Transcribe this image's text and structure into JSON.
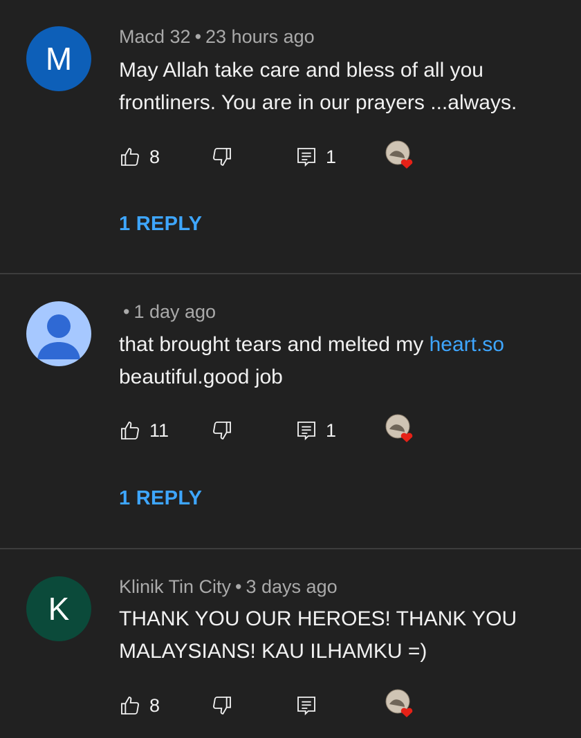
{
  "comments": [
    {
      "avatar_letter": "M",
      "avatar_color": "#0d5fb8",
      "author": "Macd 32",
      "separator": "•",
      "time": "23 hours ago",
      "text": "May Allah take care and bless of all you frontliners. You are in our prayers ...always.",
      "likes": "8",
      "reply_count": "1",
      "replies_label": "1 REPLY"
    },
    {
      "avatar_icon": "default-user-icon",
      "avatar_color": "#a6c8ff",
      "author": "",
      "separator": "•",
      "time": "1 day ago",
      "text_before": "that brought tears and melted my ",
      "link_text": "heart.so",
      "text_after": "beautiful.good job",
      "likes": "11",
      "reply_count": "1",
      "replies_label": "1 REPLY"
    },
    {
      "avatar_letter": "K",
      "avatar_color": "#0b4a3a",
      "author": "Klinik Tin City",
      "separator": "•",
      "time": "3 days ago",
      "text": "THANK YOU OUR HEROES! THANK YOU MALAYSIANS! KAU ILHAMKU =)",
      "likes": "8"
    }
  ],
  "colors": {
    "background": "#212121",
    "link": "#3ea6ff",
    "meta": "#aaaaaa",
    "heart": "#e62117"
  }
}
